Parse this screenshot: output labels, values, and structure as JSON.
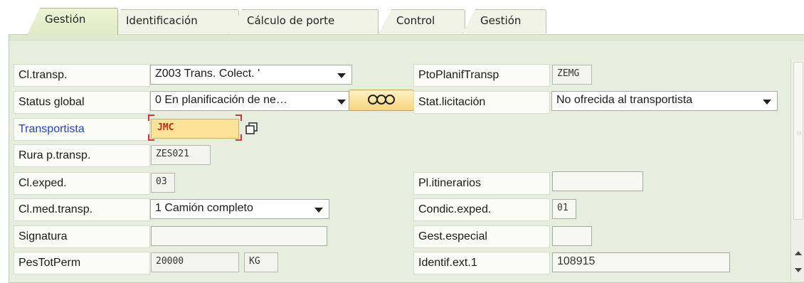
{
  "tabs": [
    {
      "label": "Gestión",
      "active": true
    },
    {
      "label": "Identificación",
      "active": false
    },
    {
      "label": "Cálculo de porte",
      "active": false
    },
    {
      "label": "Control",
      "active": false
    },
    {
      "label": "Gestión",
      "active": false
    }
  ],
  "form": {
    "cl_transp": {
      "label": "Cl.transp.",
      "value": "Z003 Trans. Colect.  '"
    },
    "status_global": {
      "label": "Status global",
      "value": "0 En planificación de ne…",
      "button_icon": "ooo-icon"
    },
    "transportista": {
      "label": "Transportista",
      "value": "JMC"
    },
    "rura": {
      "label": "Rura p.transp.",
      "value": "ZES021"
    },
    "cl_exped": {
      "label": "Cl.exped.",
      "value": "03"
    },
    "cl_med": {
      "label": "Cl.med.transp.",
      "value": "1 Camión completo"
    },
    "signatura": {
      "label": "Signatura",
      "value": ""
    },
    "pes_tot": {
      "label": "PesTotPerm",
      "value": "20000",
      "unit": "KG"
    },
    "pto_planif": {
      "label": "PtoPlanifTransp",
      "value": "ZEMG"
    },
    "stat_lic": {
      "label": "Stat.licitación",
      "value": "No ofrecida al transportista"
    },
    "pl_itin": {
      "label": "Pl.itinerarios",
      "value": ""
    },
    "condic": {
      "label": "Condic.exped.",
      "value": "01"
    },
    "gest_esp": {
      "label": "Gest.especial",
      "value": ""
    },
    "identif": {
      "label": "Identif.ext.1",
      "value": "108915"
    }
  },
  "colors": {
    "panel_bg": "#e7eedd",
    "required_field_bg": "#fde29a",
    "link_label": "#2244cc"
  }
}
